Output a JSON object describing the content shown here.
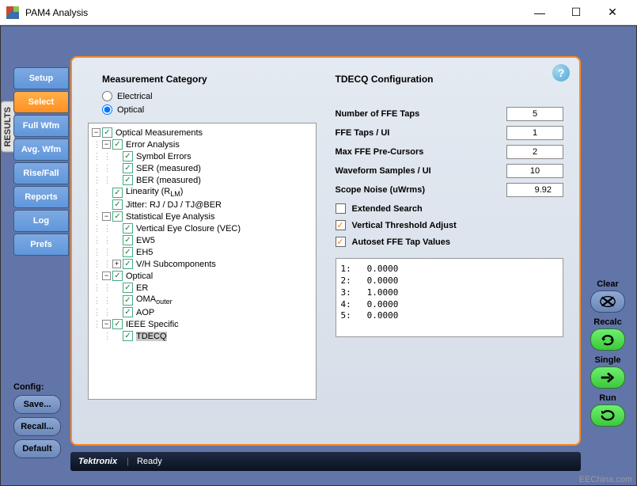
{
  "window": {
    "title": "PAM4 Analysis"
  },
  "tabs": {
    "setup": "Setup",
    "select": "Select",
    "full_wfm": "Full Wfm",
    "avg_wfm": "Avg. Wfm",
    "rise_fall": "Rise/Fall",
    "reports": "Reports",
    "log": "Log",
    "prefs": "Prefs"
  },
  "results_tab": "RESULTS",
  "config": {
    "label": "Config:",
    "save": "Save...",
    "recall": "Recall...",
    "default": "Default"
  },
  "right_buttons": {
    "clear": "Clear",
    "recalc": "Recalc",
    "single": "Single",
    "run": "Run"
  },
  "help_tooltip": "?",
  "category": {
    "title": "Measurement Category",
    "electrical": "Electrical",
    "optical": "Optical",
    "selected": "Optical"
  },
  "tree": {
    "root": "Optical Measurements",
    "error_analysis": "Error Analysis",
    "symbol_errors": "Symbol Errors",
    "ser": "SER (measured)",
    "ber": "BER (measured)",
    "linearity": "Linearity (R",
    "linearity_sub": "LM",
    "linearity_end": ")",
    "jitter": "Jitter: RJ / DJ / TJ@BER",
    "stat_eye": "Statistical Eye Analysis",
    "vec": "Vertical Eye Closure (VEC)",
    "ew5": "EW5",
    "eh5": "EH5",
    "vh": "V/H Subcomponents",
    "optical": "Optical",
    "er": "ER",
    "oma": "OMA",
    "oma_sub": "outer",
    "aop": "AOP",
    "ieee": "IEEE Specific",
    "tdecq": "TDECQ"
  },
  "tdecq": {
    "title": "TDECQ Configuration",
    "ffe_taps": {
      "label": "Number of FFE Taps",
      "value": "5"
    },
    "taps_ui": {
      "label": "FFE Taps / UI",
      "value": "1"
    },
    "precursors": {
      "label": "Max FFE Pre-Cursors",
      "value": "2"
    },
    "samples_ui": {
      "label": "Waveform Samples / UI",
      "value": "10"
    },
    "scope_noise": {
      "label": "Scope Noise (uWrms)",
      "value": "9.92"
    },
    "extended": "Extended Search",
    "vthresh": "Vertical Threshold Adjust",
    "autoset": "Autoset FFE Tap Values",
    "output": "1:   0.0000\n2:   0.0000\n3:   1.0000\n4:   0.0000\n5:   0.0000"
  },
  "status": {
    "brand": "Tektronix",
    "state": "Ready"
  },
  "watermark": "EEChina.com"
}
